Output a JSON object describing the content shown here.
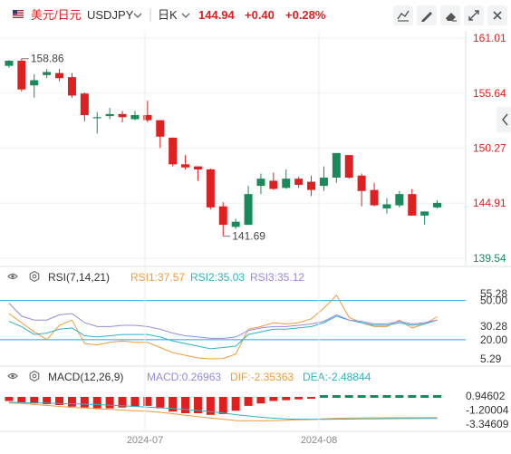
{
  "header": {
    "pair_name": "美元/日元",
    "symbol": "USDJPY",
    "period": "日K",
    "last_price": "144.94",
    "change": "+0.40",
    "change_pct": "+0.28%",
    "up_color": "#e02020",
    "down_color": "#1a8a5a",
    "toolbar_icons": [
      "compare-icon",
      "draw-icon",
      "eraser-icon",
      "fullscreen-icon",
      "close-icon"
    ]
  },
  "chart_data": [
    {
      "type": "candlestick",
      "title": "USDJPY 日K",
      "ylim": [
        139.54,
        161.01
      ],
      "y_ticks": [
        "161.01",
        "155.64",
        "150.27",
        "144.91",
        "139.54"
      ],
      "annotations": [
        {
          "text": "158.86",
          "kind": "high"
        },
        {
          "text": "141.69",
          "kind": "low"
        }
      ],
      "candles": [
        {
          "o": 158.3,
          "c": 158.8,
          "h": 158.86,
          "l": 158.1
        },
        {
          "o": 158.8,
          "c": 156.0,
          "h": 159.0,
          "l": 155.8
        },
        {
          "o": 156.4,
          "c": 156.9,
          "h": 157.5,
          "l": 155.2
        },
        {
          "o": 157.4,
          "c": 157.7,
          "h": 158.0,
          "l": 157.1
        },
        {
          "o": 157.6,
          "c": 157.1,
          "h": 158.0,
          "l": 156.8
        },
        {
          "o": 157.2,
          "c": 155.4,
          "h": 157.6,
          "l": 155.2
        },
        {
          "o": 155.6,
          "c": 153.5,
          "h": 155.7,
          "l": 152.9
        },
        {
          "o": 153.2,
          "c": 153.3,
          "h": 153.8,
          "l": 151.7
        },
        {
          "o": 153.4,
          "c": 153.6,
          "h": 154.2,
          "l": 153.1
        },
        {
          "o": 153.6,
          "c": 153.3,
          "h": 153.9,
          "l": 152.8
        },
        {
          "o": 153.1,
          "c": 153.5,
          "h": 153.9,
          "l": 153.0
        },
        {
          "o": 153.5,
          "c": 153.0,
          "h": 154.9,
          "l": 152.8
        },
        {
          "o": 153.0,
          "c": 151.4,
          "h": 153.0,
          "l": 150.3
        },
        {
          "o": 151.3,
          "c": 148.7,
          "h": 151.3,
          "l": 148.5
        },
        {
          "o": 148.7,
          "c": 148.4,
          "h": 149.6,
          "l": 148.2
        },
        {
          "o": 148.5,
          "c": 148.2,
          "h": 148.5,
          "l": 147.1
        },
        {
          "o": 148.2,
          "c": 144.5,
          "h": 148.3,
          "l": 144.3
        },
        {
          "o": 144.6,
          "c": 142.8,
          "h": 145.0,
          "l": 141.69
        },
        {
          "o": 142.6,
          "c": 143.1,
          "h": 143.4,
          "l": 142.4
        },
        {
          "o": 142.8,
          "c": 145.8,
          "h": 146.6,
          "l": 142.8
        },
        {
          "o": 146.6,
          "c": 147.3,
          "h": 147.8,
          "l": 145.8
        },
        {
          "o": 147.1,
          "c": 146.3,
          "h": 147.9,
          "l": 146.2
        },
        {
          "o": 146.4,
          "c": 147.3,
          "h": 148.2,
          "l": 146.3
        },
        {
          "o": 147.3,
          "c": 146.7,
          "h": 147.5,
          "l": 146.4
        },
        {
          "o": 147.0,
          "c": 146.2,
          "h": 147.6,
          "l": 145.6
        },
        {
          "o": 146.6,
          "c": 147.4,
          "h": 148.5,
          "l": 146.1
        },
        {
          "o": 147.4,
          "c": 149.8,
          "h": 149.8,
          "l": 146.9
        },
        {
          "o": 149.6,
          "c": 147.4,
          "h": 149.6,
          "l": 147.3
        },
        {
          "o": 147.6,
          "c": 146.1,
          "h": 147.8,
          "l": 144.6
        },
        {
          "o": 146.2,
          "c": 144.7,
          "h": 146.9,
          "l": 144.6
        },
        {
          "o": 144.4,
          "c": 144.8,
          "h": 145.4,
          "l": 143.9
        },
        {
          "o": 144.7,
          "c": 145.8,
          "h": 146.1,
          "l": 144.5
        },
        {
          "o": 145.8,
          "c": 143.7,
          "h": 146.3,
          "l": 143.7
        },
        {
          "o": 143.7,
          "c": 144.1,
          "h": 144.1,
          "l": 142.8
        },
        {
          "o": 144.5,
          "c": 144.94,
          "h": 145.2,
          "l": 144.4
        }
      ]
    },
    {
      "type": "line",
      "indicator": "RSI",
      "label": "RSI(7,14,21)",
      "ylim": [
        5.29,
        55.28
      ],
      "y_ticks": [
        "55.28",
        "50.00",
        "30.28",
        "20.00",
        "5.29"
      ],
      "h_lines": [
        50.0,
        20.0
      ],
      "series": [
        {
          "name": "RSI1:37.57",
          "color": "#f39a3a",
          "values": [
            40,
            33,
            26,
            20,
            31,
            35,
            17,
            16,
            18,
            19,
            18,
            18,
            14,
            10,
            8,
            6,
            5.3,
            5.5,
            9,
            28,
            30,
            33,
            32,
            33,
            36,
            44,
            54,
            37,
            33,
            30,
            30,
            35,
            29,
            32,
            37.6
          ]
        },
        {
          "name": "RSI2:35.03",
          "color": "#2cb3c6",
          "values": [
            34,
            30,
            24,
            25,
            28,
            29,
            23,
            22,
            23,
            24,
            24,
            24,
            22,
            19,
            17,
            15,
            13,
            14,
            15,
            24,
            26,
            28,
            28,
            29,
            30,
            33,
            38,
            35,
            33,
            31,
            31,
            33,
            31,
            32,
            35.0
          ]
        },
        {
          "name": "RSI3:35.12",
          "color": "#9c86e0",
          "values": [
            48,
            38,
            35,
            35,
            39,
            40,
            33,
            30,
            30,
            31,
            31,
            30,
            28,
            25,
            23,
            22,
            21,
            21,
            22,
            27,
            29,
            30,
            30,
            31,
            32,
            34,
            39,
            35,
            34,
            32,
            32,
            34,
            32,
            33,
            35.1
          ]
        }
      ]
    },
    {
      "type": "bar+line",
      "indicator": "MACD",
      "label": "MACD(12,26,9)",
      "ylim": [
        -3.34609,
        0.94602
      ],
      "y_ticks": [
        "0.94602",
        "-1.20004",
        "-3.34609"
      ],
      "legend": [
        {
          "text": "MACD:0.26963",
          "color": "#9c86e0"
        },
        {
          "text": "DIF:-2.35363",
          "color": "#f39a3a"
        },
        {
          "text": "DEA:-2.48844",
          "color": "#2cb3c6"
        }
      ],
      "macd_values": [
        -0.25,
        -0.35,
        -0.4,
        -0.45,
        -0.5,
        -0.6,
        -0.65,
        -0.7,
        -0.7,
        -0.65,
        -0.6,
        -0.55,
        -0.7,
        -0.9,
        -1.0,
        -1.0,
        -1.1,
        -1.05,
        -0.85,
        -0.55,
        -0.4,
        -0.25,
        -0.2,
        -0.15,
        -0.1,
        0.05,
        0.25,
        0.25,
        0.25,
        0.25,
        0.25,
        0.25,
        0.25,
        0.25,
        0.27
      ],
      "dif": [
        -0.1,
        -0.2,
        -0.35,
        -0.5,
        -0.65,
        -0.8,
        -0.9,
        -1.0,
        -1.1,
        -1.2,
        -1.3,
        -1.4,
        -1.55,
        -1.75,
        -2.0,
        -2.2,
        -2.4,
        -2.6,
        -2.8,
        -2.85,
        -2.85,
        -2.8,
        -2.75,
        -2.7,
        -2.65,
        -2.55,
        -2.45,
        -2.42,
        -2.4,
        -2.38,
        -2.38,
        -2.37,
        -2.36,
        -2.36,
        -2.35
      ],
      "dea": [
        0.0,
        -0.05,
        -0.1,
        -0.15,
        -0.2,
        -0.25,
        -0.3,
        -0.35,
        -0.45,
        -0.55,
        -0.65,
        -0.75,
        -0.85,
        -0.95,
        -1.1,
        -1.25,
        -1.45,
        -1.65,
        -1.9,
        -2.1,
        -2.3,
        -2.45,
        -2.55,
        -2.6,
        -2.6,
        -2.62,
        -2.6,
        -2.58,
        -2.56,
        -2.54,
        -2.52,
        -2.5,
        -2.5,
        -2.49,
        -2.49
      ]
    }
  ],
  "x_labels": [
    "2024-07",
    "2024-08"
  ]
}
